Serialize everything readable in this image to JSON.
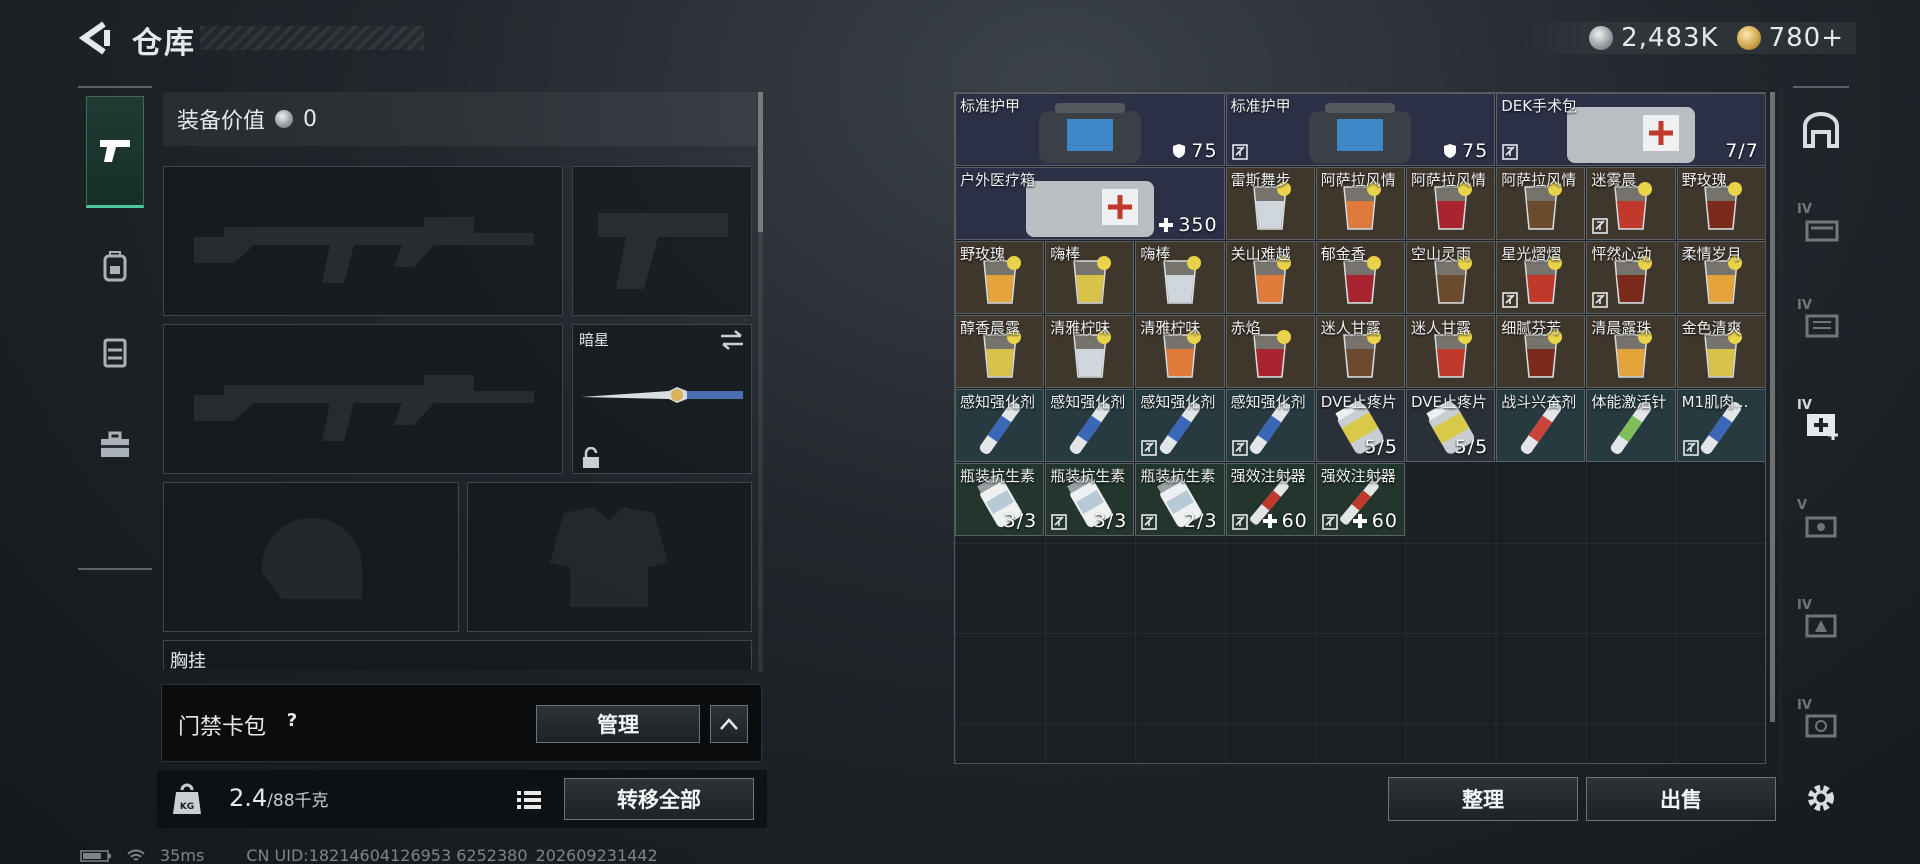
{
  "header": {
    "title": "仓库",
    "silver": "2,483K",
    "gold": "780+"
  },
  "equipment": {
    "value_label": "装备价值",
    "value": "0",
    "melee_name": "暗星",
    "chest_rig_label": "胸挂",
    "card_pack_label": "门禁卡包",
    "card_pack_help": "?",
    "manage_label": "管理"
  },
  "bottom_left": {
    "weight": "2.4",
    "weight_max": "/88千克",
    "transfer_all_label": "转移全部"
  },
  "status": {
    "ping": "35ms",
    "uid": "CN UID:18214604126953 6252380_202609231442"
  },
  "bottom_right": {
    "organize_label": "整理",
    "sell_label": "出售"
  },
  "colors": {
    "accent": "#4fc7a0",
    "armor_cell": "#2b3047",
    "drink_cell": "#40372c",
    "injector_cell": "#263a40",
    "medic_cell": "#23352c"
  },
  "items": [
    {
      "name": "标准护甲",
      "count": "75",
      "kind": "armor",
      "bound": false,
      "tag": "shield"
    },
    {
      "name": "标准护甲",
      "count": "75",
      "kind": "armor",
      "bound": true,
      "tag": "shield"
    },
    {
      "name": "DEK手术包",
      "count": "7/7",
      "kind": "medkit",
      "bound": true,
      "tag": ""
    },
    {
      "name": "户外医疗箱",
      "count": "350",
      "kind": "medkit",
      "bound": false,
      "tag": "plus"
    },
    {
      "name": "雷斯舞步",
      "count": "",
      "kind": "drink",
      "bound": false
    },
    {
      "name": "阿萨拉风情",
      "count": "",
      "kind": "drink",
      "bound": false
    },
    {
      "name": "阿萨拉风情",
      "count": "",
      "kind": "drink",
      "bound": false
    },
    {
      "name": "阿萨拉风情",
      "count": "",
      "kind": "drink",
      "bound": false
    },
    {
      "name": "迷雾晨",
      "count": "",
      "kind": "drink",
      "bound": true
    },
    {
      "name": "野玫瑰",
      "count": "",
      "kind": "drink",
      "bound": false
    },
    {
      "name": "野玫瑰",
      "count": "",
      "kind": "drink",
      "bound": false
    },
    {
      "name": "嗨棒",
      "count": "",
      "kind": "drink",
      "bound": false
    },
    {
      "name": "嗨棒",
      "count": "",
      "kind": "drink",
      "bound": false
    },
    {
      "name": "关山难越",
      "count": "",
      "kind": "drink",
      "bound": false
    },
    {
      "name": "郁金香",
      "count": "",
      "kind": "drink",
      "bound": false
    },
    {
      "name": "空山灵雨",
      "count": "",
      "kind": "drink",
      "bound": false
    },
    {
      "name": "星光熠熠",
      "count": "",
      "kind": "drink",
      "bound": true
    },
    {
      "name": "怦然心动",
      "count": "",
      "kind": "drink",
      "bound": true
    },
    {
      "name": "柔情岁月",
      "count": "",
      "kind": "drink",
      "bound": false
    },
    {
      "name": "醇香晨露",
      "count": "",
      "kind": "drink",
      "bound": false
    },
    {
      "name": "清雅柠味",
      "count": "",
      "kind": "drink",
      "bound": false
    },
    {
      "name": "清雅柠味",
      "count": "",
      "kind": "drink",
      "bound": false
    },
    {
      "name": "赤焰",
      "count": "",
      "kind": "drink",
      "bound": false
    },
    {
      "name": "迷人甘露",
      "count": "",
      "kind": "drink",
      "bound": false
    },
    {
      "name": "迷人甘露",
      "count": "",
      "kind": "drink",
      "bound": false
    },
    {
      "name": "细腻芬芳",
      "count": "",
      "kind": "drink",
      "bound": false
    },
    {
      "name": "清晨露珠",
      "count": "",
      "kind": "drink",
      "bound": false
    },
    {
      "name": "金色清爽",
      "count": "",
      "kind": "drink",
      "bound": false
    },
    {
      "name": "感知强化剂",
      "count": "",
      "kind": "injector",
      "bound": false
    },
    {
      "name": "感知强化剂",
      "count": "",
      "kind": "injector",
      "bound": false
    },
    {
      "name": "感知强化剂",
      "count": "",
      "kind": "injector",
      "bound": true
    },
    {
      "name": "感知强化剂",
      "count": "",
      "kind": "injector",
      "bound": true
    },
    {
      "name": "DVE止疼片",
      "count": "5/5",
      "kind": "pills",
      "bound": false
    },
    {
      "name": "DVE止疼片",
      "count": "5/5",
      "kind": "pills",
      "bound": false
    },
    {
      "name": "战斗兴奋剂",
      "count": "",
      "kind": "injector",
      "bound": false
    },
    {
      "name": "体能激活针",
      "count": "",
      "kind": "injector",
      "bound": false
    },
    {
      "name": "M1肌肉...",
      "count": "",
      "kind": "injector",
      "bound": true
    },
    {
      "name": "瓶装抗生素",
      "count": "3/3",
      "kind": "bottle",
      "bound": false
    },
    {
      "name": "瓶装抗生素",
      "count": "3/3",
      "kind": "bottle",
      "bound": true
    },
    {
      "name": "瓶装抗生素",
      "count": "2/3",
      "kind": "bottle",
      "bound": true
    },
    {
      "name": "强效注射器",
      "count": "60",
      "kind": "syringe",
      "bound": true,
      "tag": "plus"
    },
    {
      "name": "强效注射器",
      "count": "60",
      "kind": "syringe",
      "bound": true,
      "tag": "plus"
    }
  ],
  "right_nav": [
    {
      "icon": "warehouse-icon",
      "tier": ""
    },
    {
      "icon": "armory-icon",
      "tier": "IV"
    },
    {
      "icon": "storage-icon",
      "tier": "IV"
    },
    {
      "icon": "medical-icon",
      "tier": "IV"
    },
    {
      "icon": "workbench-icon",
      "tier": "V"
    },
    {
      "icon": "tech-icon",
      "tier": "IV"
    },
    {
      "icon": "safe-icon",
      "tier": "IV"
    }
  ]
}
